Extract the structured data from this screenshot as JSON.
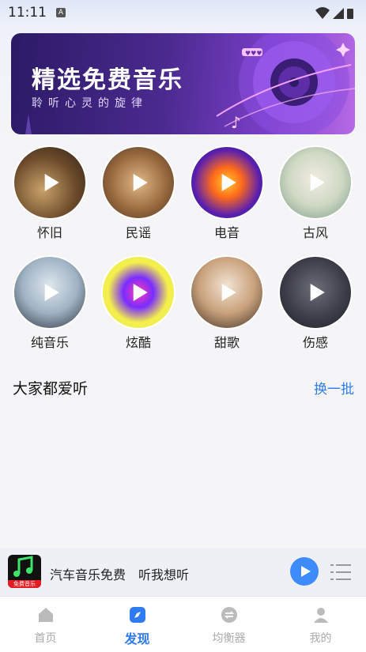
{
  "status": {
    "time": "11:11",
    "indicator": "A"
  },
  "banner": {
    "title": "精选免费音乐",
    "subtitle": "聆听心灵的旋律"
  },
  "categories": [
    {
      "label": "怀旧",
      "icon": "play-icon"
    },
    {
      "label": "民谣",
      "icon": "play-icon"
    },
    {
      "label": "电音",
      "icon": "play-icon"
    },
    {
      "label": "古风",
      "icon": "play-icon"
    },
    {
      "label": "纯音乐",
      "icon": "play-icon"
    },
    {
      "label": "炫酷",
      "icon": "play-icon"
    },
    {
      "label": "甜歌",
      "icon": "play-icon"
    },
    {
      "label": "伤感",
      "icon": "play-icon"
    }
  ],
  "section": {
    "title": "大家都爱听",
    "refresh_label": "换一批"
  },
  "player": {
    "cover_tag": "免费音乐",
    "song": "汽车音乐免费　听我想听"
  },
  "tabs": [
    {
      "label": "首页",
      "icon": "home-icon",
      "active": false
    },
    {
      "label": "发现",
      "icon": "compass-icon",
      "active": true
    },
    {
      "label": "均衡器",
      "icon": "equalizer-icon",
      "active": false
    },
    {
      "label": "我的",
      "icon": "person-icon",
      "active": false
    }
  ],
  "colors": {
    "accent": "#2f7bf0",
    "play_button": "#3d8bfd",
    "banner_dark": "#2c1a66",
    "banner_light": "#b86ae6"
  }
}
